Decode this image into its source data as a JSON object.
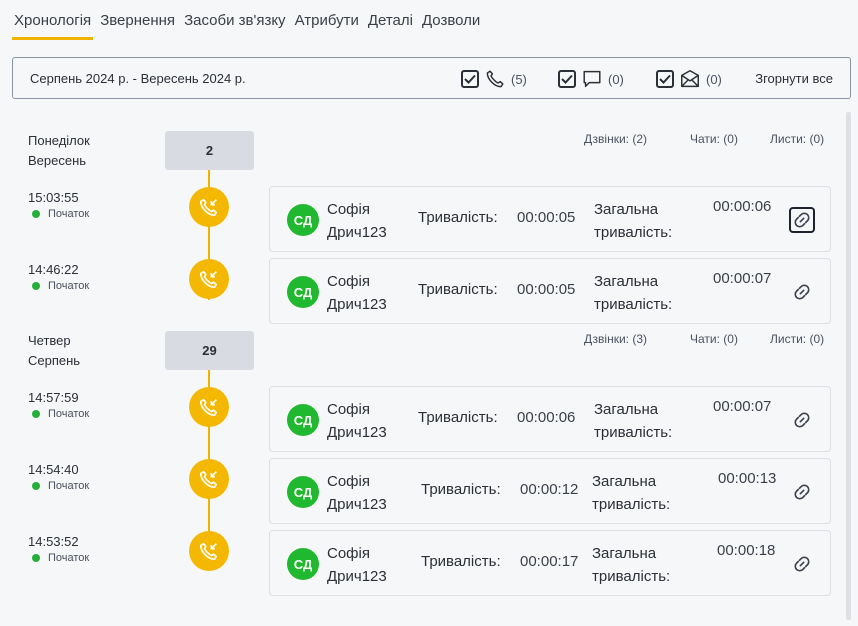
{
  "tabs": [
    {
      "label": "Хронологія",
      "active": true
    },
    {
      "label": "Звернення"
    },
    {
      "label": "Засоби зв'язку"
    },
    {
      "label": "Атрибути"
    },
    {
      "label": "Деталі"
    },
    {
      "label": "Дозволи"
    }
  ],
  "filter": {
    "range": "Серпень 2024 р. - Вересень 2024 р.",
    "calls": {
      "count": "(5)",
      "checked": true,
      "icon": "phone-icon"
    },
    "chats": {
      "count": "(0)",
      "checked": true,
      "icon": "chat-icon"
    },
    "mails": {
      "count": "(0)",
      "checked": true,
      "icon": "mail-icon"
    },
    "collapse_all": "Згорнути все"
  },
  "days": [
    {
      "weekday": "Понеділок",
      "month": "Вересень",
      "date": "2",
      "calls": "Дзвінки: (2)",
      "chats": "Чати: (0)",
      "mails": "Листи: (0)",
      "events": [
        {
          "time": "15:03:55",
          "status": "Початок",
          "initials": "СД",
          "name1": "Софія",
          "name2": "Дрич123",
          "dur_label": "Тривалість:",
          "dur": "00:00:05",
          "total_label1": "Загальна",
          "total_label2": "тривалість:",
          "total": "00:00:06"
        },
        {
          "time": "14:46:22",
          "status": "Початок",
          "initials": "СД",
          "name1": "Софія",
          "name2": "Дрич123",
          "dur_label": "Тривалість:",
          "dur": "00:00:05",
          "total_label1": "Загальна",
          "total_label2": "тривалість:",
          "total": "00:00:07"
        }
      ]
    },
    {
      "weekday": "Четвер",
      "month": "Серпень",
      "date": "29",
      "calls": "Дзвінки: (3)",
      "chats": "Чати: (0)",
      "mails": "Листи: (0)",
      "events": [
        {
          "time": "14:57:59",
          "status": "Початок",
          "initials": "СД",
          "name1": "Софія",
          "name2": "Дрич123",
          "dur_label": "Тривалість:",
          "dur": "00:00:06",
          "total_label1": "Загальна",
          "total_label2": "тривалість:",
          "total": "00:00:07"
        },
        {
          "time": "14:54:40",
          "status": "Початок",
          "initials": "СД",
          "name1": "Софія",
          "name2": "Дрич123",
          "dur_label": "Тривалість:",
          "dur": "00:00:12",
          "total_label1": "Загальна",
          "total_label2": "тривалість:",
          "total": "00:00:13"
        },
        {
          "time": "14:53:52",
          "status": "Початок",
          "initials": "СД",
          "name1": "Софія",
          "name2": "Дрич123",
          "dur_label": "Тривалість:",
          "dur": "00:00:17",
          "total_label1": "Загальна",
          "total_label2": "тривалість:",
          "total": "00:00:18"
        }
      ]
    }
  ],
  "colors": {
    "accent": "#f0b400",
    "avatar": "#1fb82e",
    "status_dot": "#27ae3a"
  }
}
